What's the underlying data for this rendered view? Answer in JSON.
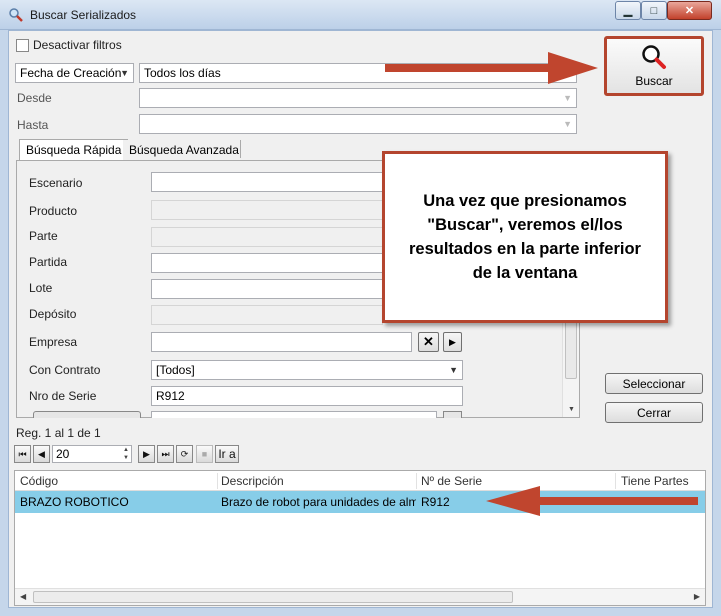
{
  "window": {
    "title": "Buscar Serializados",
    "controls": {
      "minimize": "▁",
      "maximize": "□",
      "close": "✕"
    }
  },
  "filters": {
    "disable_filters_label": "Desactivar filtros",
    "disable_filters_checked": false,
    "date_type_value": "Fecha de Creación",
    "date_range_value": "Todos los días",
    "from_label": "Desde",
    "to_label": "Hasta"
  },
  "tabs": [
    {
      "label": "Búsqueda Rápida",
      "active": true
    },
    {
      "label": "Búsqueda Avanzada",
      "active": false
    }
  ],
  "form": {
    "escenario_label": "Escenario",
    "producto_label": "Producto",
    "parte_label": "Parte",
    "partida_label": "Partida",
    "lote_label": "Lote",
    "deposito_label": "Depósito",
    "empresa_label": "Empresa",
    "con_contrato_label": "Con Contrato",
    "con_contrato_value": "[Todos]",
    "nro_serie_label": "Nro de Serie",
    "nro_serie_value": "R912"
  },
  "buttons": {
    "buscar": "Buscar",
    "seleccionar": "Seleccionar",
    "cerrar": "Cerrar",
    "ir_a": "Ir a"
  },
  "pager": {
    "record_info": "Reg. 1 al 1 de 1",
    "page_size": "20"
  },
  "grid": {
    "columns": [
      "Código",
      "Descripción",
      "Nº de Serie",
      "Tiene Partes"
    ],
    "rows": [
      {
        "codigo": "BRAZO ROBOTICO",
        "descripcion": "Brazo de robot para unidades de almacenamiento",
        "serie": "R912",
        "tiene_partes": ""
      }
    ]
  },
  "annotation": {
    "callout_text": "Una vez que presionamos \"Buscar\", veremos el/los resultados en la parte inferior de la ventana"
  },
  "colors": {
    "arrow": "#c0452e",
    "selected_row": "#87cde8",
    "title_bar": "#c8d9ee"
  },
  "icons": [
    "search-icon",
    "first-page-icon",
    "prev-page-icon",
    "next-page-icon",
    "last-page-icon",
    "refresh-icon",
    "stop-icon",
    "clear-icon",
    "arrow-right-icon"
  ]
}
